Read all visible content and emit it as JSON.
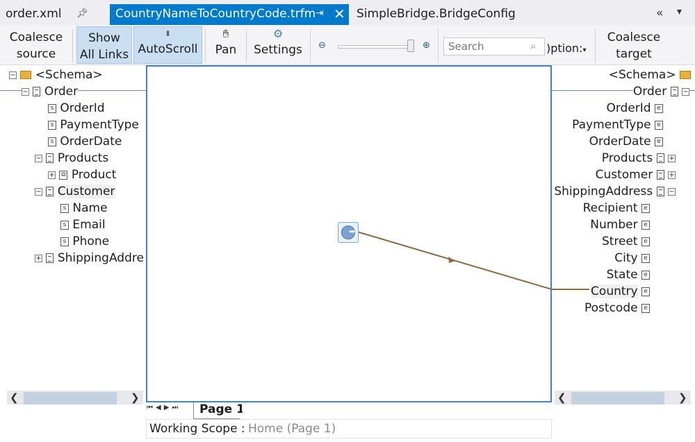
{
  "tabs": {
    "order_file": "order.xml",
    "active_file": "CountryNameToCountryCode.trfm",
    "bridge_file": "SimpleBridge.BridgeConfig"
  },
  "toolbar": {
    "coalesce_source": [
      "Coalesce",
      "source"
    ],
    "show_all_links": [
      "Show",
      "All Links"
    ],
    "autoscroll": "AutoScroll",
    "pan": "Pan",
    "settings": "Settings",
    "search_placeholder": "Search",
    "options": ")ption:",
    "coalesce_target": [
      "Coalesce",
      "target"
    ]
  },
  "source_tree": {
    "root": "<Schema>",
    "order": "Order",
    "order_id": "OrderId",
    "payment_type": "PaymentType",
    "order_date": "OrderDate",
    "products": "Products",
    "product": "Product",
    "customer": "Customer",
    "name": "Name",
    "email": "Email",
    "phone": "Phone",
    "shipping_address": "ShippingAddre"
  },
  "target_tree": {
    "root": "<Schema>",
    "order": "Order",
    "order_id": "OrderId",
    "payment_type": "PaymentType",
    "order_date": "OrderDate",
    "products": "Products",
    "customer": "Customer",
    "shipping_address": "ShippingAddress",
    "recipient": "Recipient",
    "number": "Number",
    "street": "Street",
    "city": "City",
    "state": "State",
    "country": "Country",
    "postcode": "Postcode"
  },
  "page_tab": "Page 1",
  "scope": {
    "label": "Working Scope :",
    "value": "Home (Page 1)"
  },
  "colors": {
    "accent": "#007acc",
    "link_line": "#8b6a3e",
    "canvas_border": "#3e82d0"
  }
}
